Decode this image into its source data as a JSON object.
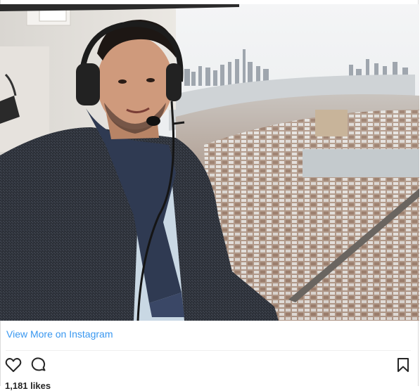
{
  "photo": {
    "alt": "Man with headset in helicopter over snowy city"
  },
  "embed": {
    "view_more_label": "View More on Instagram",
    "likes_text": "1,181 likes"
  },
  "icons": {
    "like": "heart-icon",
    "comment": "comment-icon",
    "save": "bookmark-icon"
  },
  "colors": {
    "link": "#3897f0",
    "text": "#262626"
  }
}
